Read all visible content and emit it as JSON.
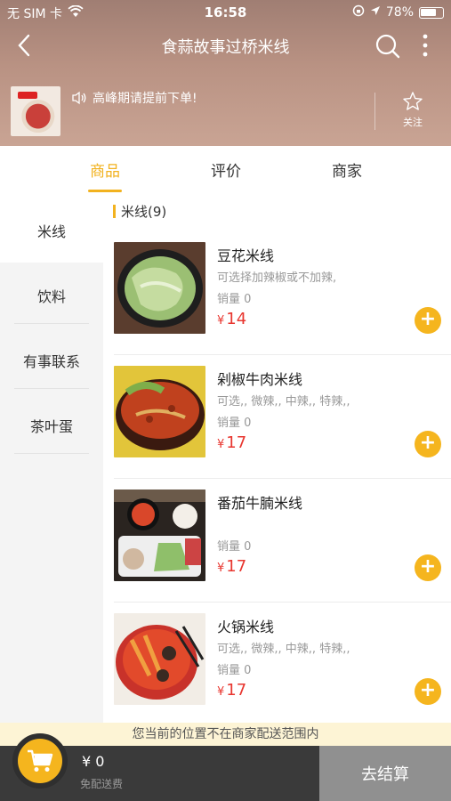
{
  "status_bar": {
    "carrier": "无 SIM 卡",
    "time": "16:58",
    "battery_percent": "78%",
    "battery_level": 0.78
  },
  "nav": {
    "title": "食蒜故事过桥米线"
  },
  "shop": {
    "notice": "高峰期请提前下单!",
    "follow_label": "关注"
  },
  "tabs": [
    {
      "label": "商品",
      "active": true
    },
    {
      "label": "评价",
      "active": false
    },
    {
      "label": "商家",
      "active": false
    }
  ],
  "categories": [
    {
      "label": "米线",
      "active": true
    },
    {
      "label": "饮料",
      "active": false
    },
    {
      "label": "有事联系",
      "active": false
    },
    {
      "label": "茶叶蛋",
      "active": false
    }
  ],
  "section": {
    "title": "米线(9)"
  },
  "products": [
    {
      "name": "豆花米线",
      "desc": "可选择加辣椒或不加辣,",
      "sales": "销量 0",
      "currency": "¥",
      "price": "14",
      "add": "+"
    },
    {
      "name": "剁椒牛肉米线",
      "desc": "可选,, 微辣,, 中辣,, 特辣,,",
      "sales": "销量 0",
      "currency": "¥",
      "price": "17",
      "add": "+"
    },
    {
      "name": "番茄牛腩米线",
      "desc": "",
      "sales": "销量 0",
      "currency": "¥",
      "price": "17",
      "add": "+"
    },
    {
      "name": "火锅米线",
      "desc": "可选,, 微辣,, 中辣,, 特辣,,",
      "sales": "销量 0",
      "currency": "¥",
      "price": "17",
      "add": "+"
    }
  ],
  "colors": {
    "accent": "#f2b21f",
    "price": "#e8362f",
    "bottom_bar": "#3a3a3a"
  },
  "footer": {
    "warning": "您当前的位置不在商家配送范围内",
    "total": "¥ 0",
    "delivery_fee": "免配送费",
    "checkout_label": "去结算"
  }
}
